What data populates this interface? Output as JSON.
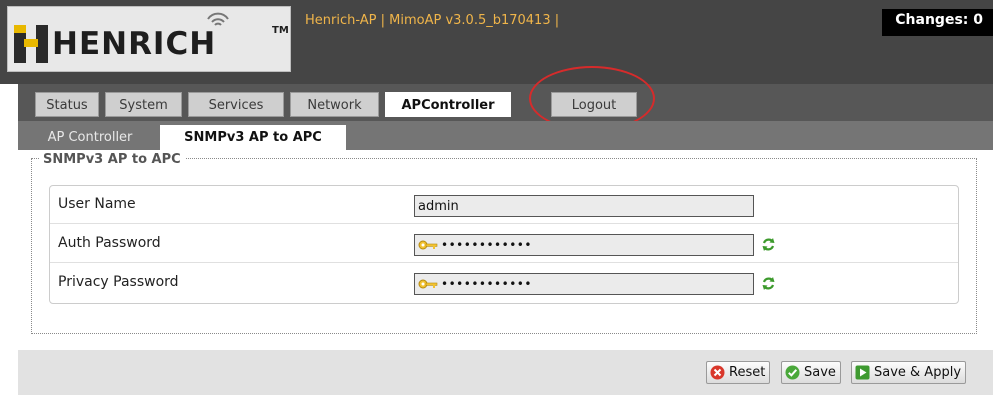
{
  "header": {
    "logo_text": "HENRICH",
    "logo_tm": "TM",
    "title": "Henrich-AP | MimoAP v3.0.5_b170413 |",
    "changes": "Changes: 0"
  },
  "nav": {
    "tabs": [
      {
        "label": "Status",
        "active": false
      },
      {
        "label": "System",
        "active": false
      },
      {
        "label": "Services",
        "active": false
      },
      {
        "label": "Network",
        "active": false
      },
      {
        "label": "APController",
        "active": true
      },
      {
        "label": "Logout",
        "active": false
      }
    ]
  },
  "subnav": {
    "tabs": [
      {
        "label": "AP Controller",
        "active": false
      },
      {
        "label": "SNMPv3 AP to APC",
        "active": true
      }
    ]
  },
  "form": {
    "legend": "SNMPv3 AP to APC",
    "fields": [
      {
        "label": "User Name",
        "value": "admin"
      },
      {
        "label": "Auth Password",
        "value": "••••••••••••"
      },
      {
        "label": "Privacy Password",
        "value": "••••••••••••"
      }
    ]
  },
  "buttons": {
    "reset": "Reset",
    "save": "Save",
    "save_apply": "Save & Apply"
  },
  "colors": {
    "header_bg": "#454545",
    "title_color": "#f0b54a",
    "nav_bg": "#575757",
    "subnav_bg": "#757575",
    "annotation_circle": "#d62b2b"
  },
  "icons": {
    "logo": "henrich-logo",
    "key": "key-icon",
    "refresh": "refresh-icon",
    "reset": "reset-icon",
    "save": "check-icon",
    "save_apply": "apply-icon"
  }
}
